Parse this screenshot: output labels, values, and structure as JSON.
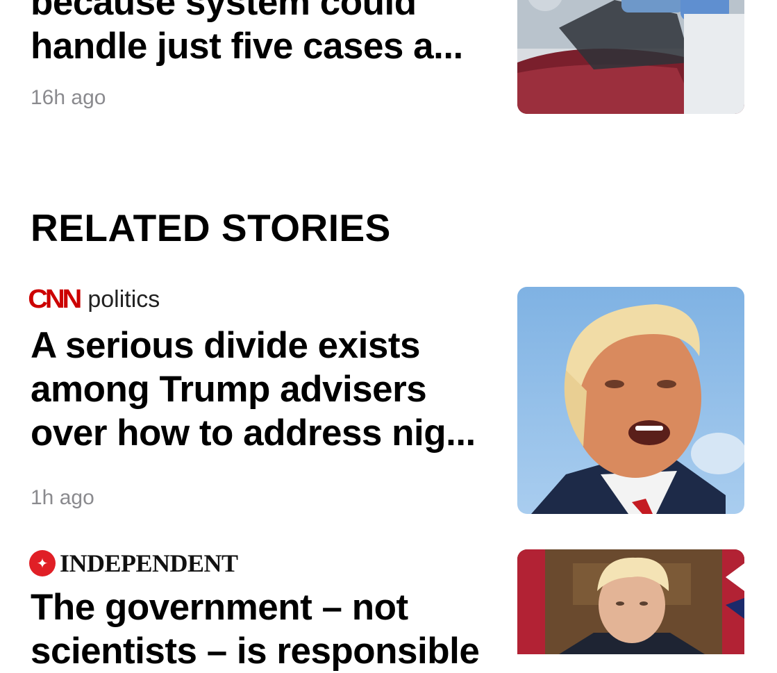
{
  "story_prev": {
    "headline_lines": [
      "because system could",
      "handle just five cases a..."
    ],
    "time": "16h ago",
    "thumbnail_icon": "covid-testing-photo"
  },
  "section": {
    "title": "RELATED STORIES"
  },
  "stories": [
    {
      "source_logo": "CNN",
      "source_section": "politics",
      "source_color": "#cc0000",
      "headline_lines": [
        "A serious divide exists",
        "among Trump advisers",
        "over how to address nig..."
      ],
      "time": "1h ago",
      "thumbnail_icon": "trump-portrait-photo"
    },
    {
      "source_logo": "INDEPENDENT",
      "source_color": "#e01f26",
      "headline_lines": [
        "The government – not",
        "scientists – is responsible"
      ],
      "thumbnail_icon": "boris-johnson-photo"
    }
  ]
}
